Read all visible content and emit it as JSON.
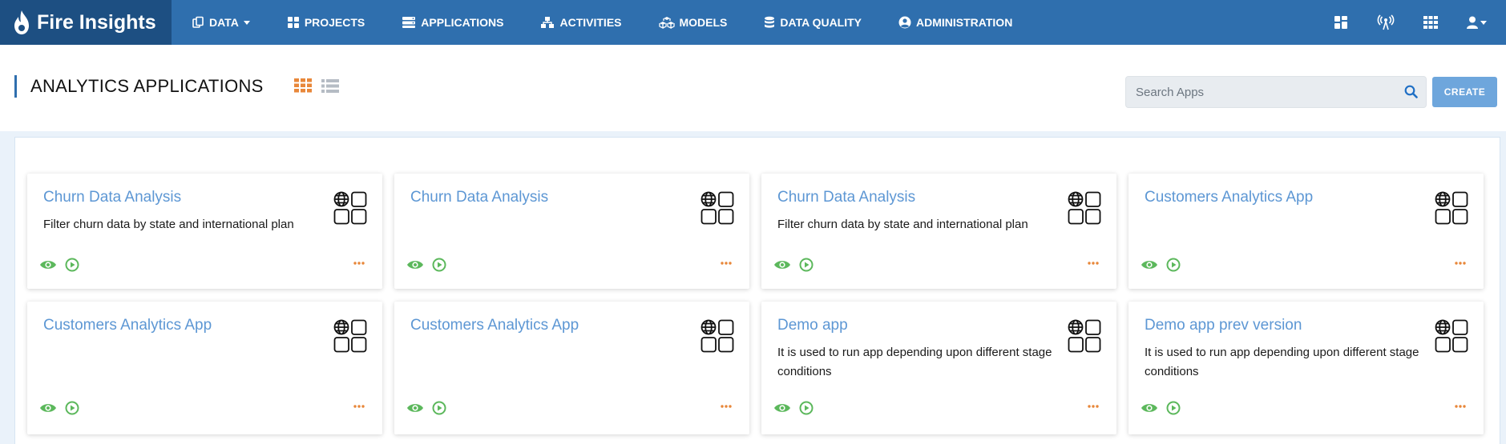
{
  "brand": {
    "name": "Fire Insights"
  },
  "nav": [
    {
      "label": "DATA",
      "icon": "data-icon",
      "dropdown": true
    },
    {
      "label": "PROJECTS",
      "icon": "projects-icon"
    },
    {
      "label": "APPLICATIONS",
      "icon": "applications-icon"
    },
    {
      "label": "ACTIVITIES",
      "icon": "activities-icon"
    },
    {
      "label": "MODELS",
      "icon": "models-icon"
    },
    {
      "label": "DATA QUALITY",
      "icon": "database-icon"
    },
    {
      "label": "ADMINISTRATION",
      "icon": "user-circle-icon"
    }
  ],
  "nav_right_icons": [
    "dashboard-icon",
    "broadcast-icon",
    "apps-grid-icon",
    "user-icon"
  ],
  "page": {
    "title": "ANALYTICS APPLICATIONS"
  },
  "search": {
    "placeholder": "Search Apps",
    "value": ""
  },
  "create": {
    "label": "CREATE"
  },
  "colors": {
    "nav": "#2f6fae",
    "brand_bg": "#1d4f82",
    "accent_title": "#5d97d4",
    "action_green": "#5cb85c",
    "more_orange": "#e8873a"
  },
  "apps": [
    {
      "title": "Churn Data Analysis",
      "description": "Filter churn data by state and international plan"
    },
    {
      "title": "Churn Data Analysis",
      "description": ""
    },
    {
      "title": "Churn Data Analysis",
      "description": "Filter churn data by state and international plan"
    },
    {
      "title": "Customers Analytics App",
      "description": ""
    },
    {
      "title": "Customers Analytics App",
      "description": ""
    },
    {
      "title": "Customers Analytics App",
      "description": ""
    },
    {
      "title": "Demo app",
      "description": "It is used to run app depending upon different stage conditions"
    },
    {
      "title": "Demo app prev version",
      "description": "It is used to run app depending upon different stage conditions"
    }
  ]
}
